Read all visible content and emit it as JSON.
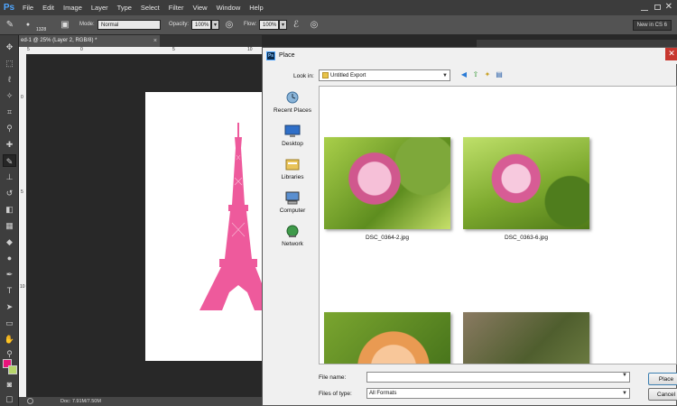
{
  "app": {
    "logo": "Ps"
  },
  "menu": [
    "File",
    "Edit",
    "Image",
    "Layer",
    "Type",
    "Select",
    "Filter",
    "View",
    "Window",
    "Help"
  ],
  "options": {
    "brush_size": "1328",
    "mode_label": "Mode:",
    "mode_value": "Normal",
    "opacity_label": "Opacity:",
    "opacity_value": "100%",
    "flow_label": "Flow:",
    "flow_value": "100%",
    "workspace": "New in CS 6"
  },
  "document": {
    "tab_title": "ed-1 @ 25% (Layer 2, RGB/8) *",
    "status": "Doc: 7.91M/7.50M"
  },
  "ruler": {
    "top_numbers": [
      "5",
      "0",
      "5",
      "10"
    ],
    "left_numbers": [
      "0",
      "5",
      "10"
    ]
  },
  "colors": {
    "foreground": "#e8137a",
    "background": "#b7d66b",
    "eiffel": "#ee5a9c"
  },
  "dialog": {
    "title": "Place",
    "look_in_label": "Look in:",
    "look_in_value": "Untitled Export",
    "places": [
      "Recent Places",
      "Desktop",
      "Libraries",
      "Computer",
      "Network"
    ],
    "files": [
      {
        "name": "DSC_0364-2.jpg"
      },
      {
        "name": "DSC_0363-6.jpg"
      },
      {
        "name": ""
      },
      {
        "name": ""
      }
    ],
    "file_name_label": "File name:",
    "file_name_value": "",
    "files_of_type_label": "Files of type:",
    "files_of_type_value": "All Formats",
    "place_button": "Place",
    "cancel_button": "Cancel"
  }
}
